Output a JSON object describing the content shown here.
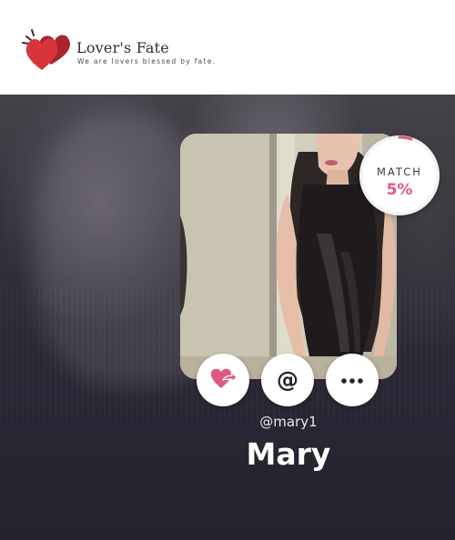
{
  "brand": {
    "name": "Lover's Fate",
    "tagline": "We are lovers blessed by fate.",
    "logo_icon": "double-heart-icon"
  },
  "profile": {
    "photo_icon": "profile-photo",
    "match_label": "MATCH",
    "match_value": "5%",
    "match_fraction": 0.05,
    "username": "@mary1",
    "display_name": "Mary"
  },
  "actions": {
    "like": {
      "icon": "heart-share-icon"
    },
    "mention": {
      "icon": "at-icon",
      "glyph": "@"
    },
    "more": {
      "icon": "more-dots-icon"
    }
  },
  "colors": {
    "accent": "#e1577e",
    "heart_red": "#d8343d",
    "heart_dark": "#a9242f"
  }
}
